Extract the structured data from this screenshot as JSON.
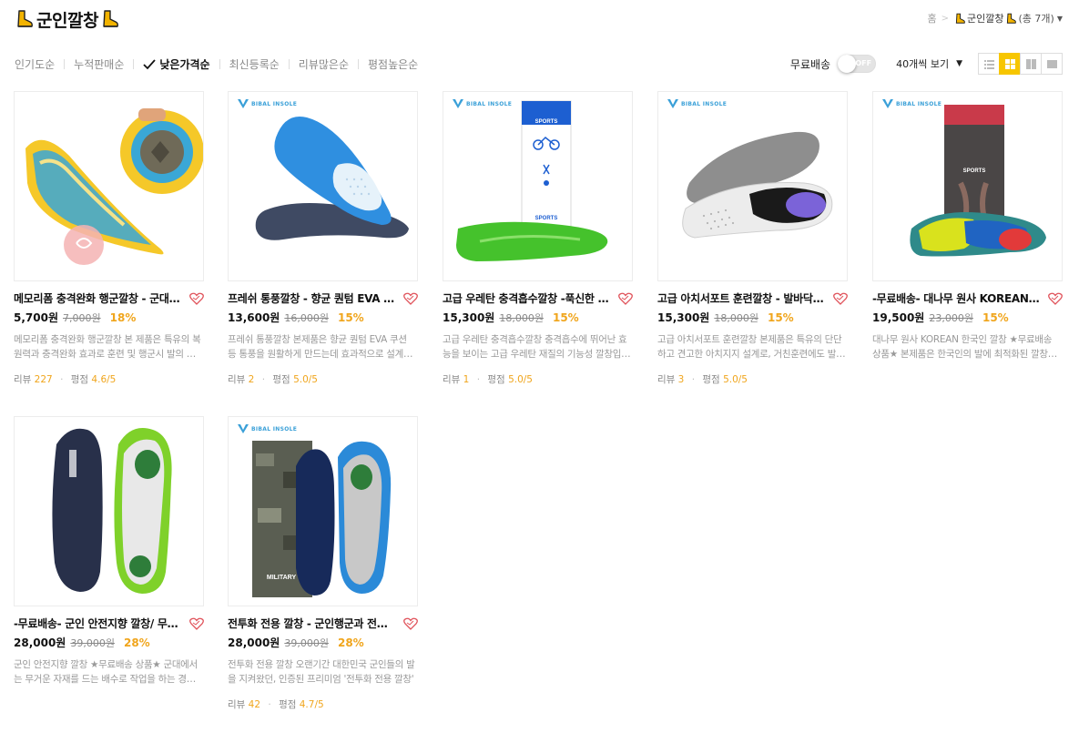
{
  "header": {
    "title": "군인깔창",
    "breadcrumb": {
      "home": "홈",
      "sep": ">",
      "current": "군인깔창",
      "count": "(총 7개)"
    }
  },
  "sort_bar": {
    "options": [
      "인기도순",
      "누적판매순",
      "낮은가격순",
      "최신등록순",
      "리뷰많은순",
      "평점높은순"
    ],
    "active_index": 2
  },
  "controls": {
    "free_shipping_label": "무료배송",
    "toggle_state": "OFF",
    "per_page_label": "40개씩 보기"
  },
  "products": [
    {
      "name": "메모리폼 충격완화 행군깔창 - 군대 군인 군화 깔창",
      "price": "5,700원",
      "original_price": "7,000원",
      "discount": "18%",
      "description": "메모리폼 충격완화 행군깔창 본 제품은 특유의 복원력과 충격완화 효과로 훈련 및 행군시 발의 피로를 줄여줍니다",
      "review_label": "리뷰",
      "review_count": "227",
      "rating_label": "평점",
      "rating": "4.6/5"
    },
    {
      "name": "프레쉬 통풍깔창 - 향균 퀀텀 EVA 쿠션 깔창",
      "price": "13,600원",
      "original_price": "16,000원",
      "discount": "15%",
      "description": "프레쉬 통풍깔창 본제품은 향균 퀀텀 EVA 쿠션 등 통풍을 원활하게 만드는데 효과적으로 설계되었습니다",
      "review_label": "리뷰",
      "review_count": "2",
      "rating_label": "평점",
      "rating": "5.0/5"
    },
    {
      "name": "고급 우레탄 충격흡수깔창 -푹신한 쿠션감",
      "price": "15,300원",
      "original_price": "18,000원",
      "discount": "15%",
      "description": "고급 우레탄 충격흡수깔창 충격흡수에 뛰어난 효능을 보이는 고급 우레탄 재질의 기능성 깔창입니다",
      "review_label": "리뷰",
      "review_count": "1",
      "rating_label": "평점",
      "rating": "5.0/5"
    },
    {
      "name": "고급 아치서포트 훈련깔창 - 발바닥 아치 지지",
      "price": "15,300원",
      "original_price": "18,000원",
      "discount": "15%",
      "description": "고급 아치서포트 훈련깔창 본제품은 특유의 단단하고 견고한 아치지지 설계로, 거친훈련에도 발을 보호합니다",
      "review_label": "리뷰",
      "review_count": "3",
      "rating_label": "평점",
      "rating": "5.0/5"
    },
    {
      "name": "-무료배송- 대나무 원사 KOREAN 한국인 깔창",
      "price": "19,500원",
      "original_price": "23,000원",
      "discount": "15%",
      "description": "대나무 원사 KOREAN 한국인 깔창 ★무료배송 상품★ 본제품은 한국인의 발에 최적화된 깔창입니다",
      "review_label": "",
      "review_count": "",
      "rating_label": "",
      "rating": ""
    },
    {
      "name": "-무료배송- 군인 안전지향 깔창/ 무게분산 깔창",
      "price": "28,000원",
      "original_price": "39,000원",
      "discount": "28%",
      "description": "군인 안전지향 깔창 ★무료배송 상품★ 군대에서는 무거운 자재를 드는 배수로 작업을 하는 경우가 많습니다",
      "review_label": "",
      "review_count": "",
      "rating_label": "",
      "rating": ""
    },
    {
      "name": "전투화 전용 깔창 - 군인행군과 전투화를 위한",
      "price": "28,000원",
      "original_price": "39,000원",
      "discount": "28%",
      "description": "전투화 전용 깔창 오랜기간 대한민국 군인들의 발을 지켜왔던, 인증된 프리미엄 '전투화 전용 깔창'",
      "review_label": "리뷰",
      "review_count": "42",
      "rating_label": "평점",
      "rating": "4.7/5"
    }
  ],
  "brand_mark": "BIBAL INSOLE",
  "box_labels": {
    "sports": "SPORTS",
    "military": "MILITARY"
  },
  "colors": {
    "accent": "#f0a51c",
    "active_view": "#f7c600",
    "boot": "#f2b300"
  }
}
